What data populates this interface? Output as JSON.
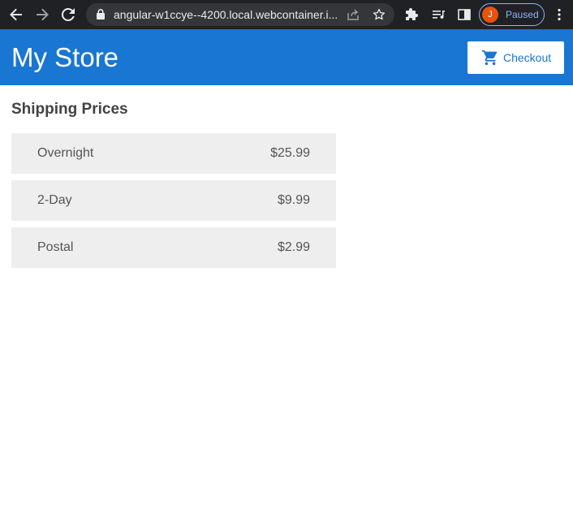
{
  "browser": {
    "url": "angular-w1ccye--4200.local.webcontainer.i...",
    "profile_initial": "J",
    "profile_status": "Paused"
  },
  "app": {
    "title": "My Store",
    "checkout_label": "Checkout",
    "accent_color": "#1976d2"
  },
  "page": {
    "heading": "Shipping Prices",
    "shipping_options": [
      {
        "type": "Overnight",
        "price": "$25.99"
      },
      {
        "type": "2-Day",
        "price": "$9.99"
      },
      {
        "type": "Postal",
        "price": "$2.99"
      }
    ]
  }
}
